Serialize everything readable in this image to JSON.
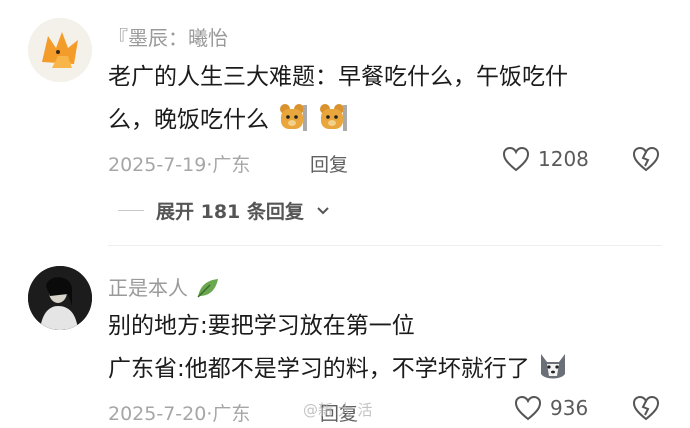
{
  "comments": [
    {
      "username": "『墨辰：曦怡",
      "line1": "老广的人生三大难题：早餐吃什么，午饭吃什",
      "line2": "么，晚饭吃什么",
      "date_location": "2025-7-19·广东",
      "reply_label": "回复",
      "likes": "1208",
      "expand_label": "展开 181 条回复",
      "emoji": "bear-emoji"
    },
    {
      "username": "正是本人",
      "line1": "别的地方:要把学习放在第一位",
      "line2": "广东省:他都不是学习的料，不学坏就行了",
      "date_location": "2025-7-20·广东",
      "reply_label": "回复",
      "likes": "936",
      "emoji": "husky-emoji"
    }
  ],
  "watermark": "@新 大 活",
  "colors": {
    "meta": "#a6a6a6",
    "text": "#1b1b1b",
    "accent_leaf": "#6aa84f"
  }
}
